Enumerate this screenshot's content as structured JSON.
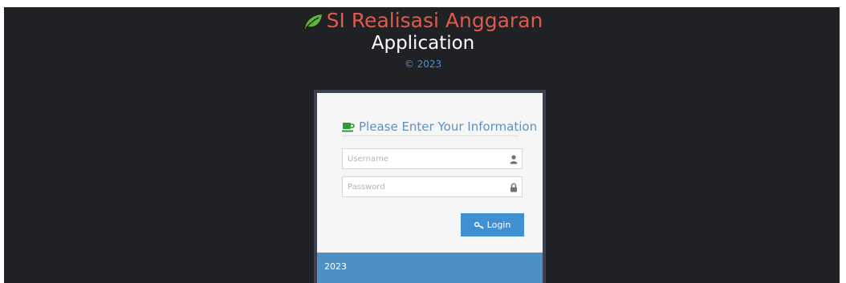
{
  "header": {
    "title": "SI Realisasi Anggaran",
    "subtitle": "Application",
    "copyright": "© 2023",
    "title_icon": "leaf-icon"
  },
  "login_form": {
    "heading": "Please Enter Your Information",
    "heading_icon": "coffee-cup-icon",
    "username": {
      "placeholder": "Username",
      "value": "",
      "icon": "user-icon"
    },
    "password": {
      "placeholder": "Password",
      "value": "",
      "icon": "lock-icon"
    },
    "submit": {
      "label": "Login",
      "icon": "key-icon"
    },
    "footer_text": "2023"
  },
  "colors": {
    "page_background": "#1f2124",
    "title_red": "#e05a4a",
    "leaf_green": "#5ab53a",
    "accent_blue": "#3f8fd2",
    "footer_blue": "#4c91c8",
    "heading_blue": "#5f90bf"
  }
}
